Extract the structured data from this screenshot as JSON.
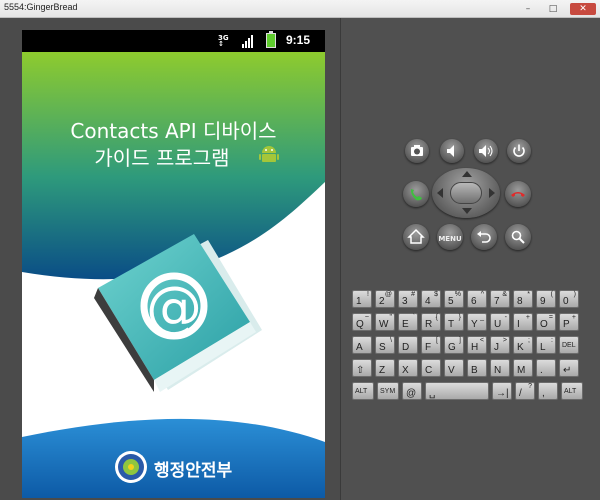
{
  "window": {
    "title": "5554:GingerBread",
    "min": "–",
    "max": "□",
    "close": "✕"
  },
  "status_bar": {
    "network": "3G",
    "time": "9:15"
  },
  "app": {
    "title_line1": "Contacts API 디바이스",
    "title_line2": "가이드 프로그램",
    "book_symbol": "@",
    "ministry_name": "행정안전부"
  },
  "hardware_buttons": {
    "camera": "camera-icon",
    "vol_down": "volume-down-icon",
    "vol_up": "volume-up-icon",
    "power": "power-icon",
    "call": "call-icon",
    "end_call": "end-call-icon",
    "home": "home-icon",
    "menu": "MENU",
    "back": "back-icon",
    "search": "search-icon"
  },
  "keyboard": {
    "rows": [
      [
        {
          "k": "1",
          "a": "!"
        },
        {
          "k": "2",
          "a": "@"
        },
        {
          "k": "3",
          "a": "#"
        },
        {
          "k": "4",
          "a": "$"
        },
        {
          "k": "5",
          "a": "%"
        },
        {
          "k": "6",
          "a": "^"
        },
        {
          "k": "7",
          "a": "&"
        },
        {
          "k": "8",
          "a": "*"
        },
        {
          "k": "9",
          "a": "("
        },
        {
          "k": "0",
          "a": ")"
        }
      ],
      [
        {
          "k": "Q",
          "a": "~"
        },
        {
          "k": "W",
          "a": "\""
        },
        {
          "k": "E",
          "a": "`"
        },
        {
          "k": "R",
          "a": "{"
        },
        {
          "k": "T",
          "a": "}"
        },
        {
          "k": "Y",
          "a": "_"
        },
        {
          "k": "U",
          "a": "-"
        },
        {
          "k": "I",
          "a": "+"
        },
        {
          "k": "O",
          "a": "="
        },
        {
          "k": "P",
          "a": "+"
        }
      ],
      [
        {
          "k": "A",
          "a": ""
        },
        {
          "k": "S",
          "a": "\\"
        },
        {
          "k": "D",
          "a": ""
        },
        {
          "k": "F",
          "a": "["
        },
        {
          "k": "G",
          "a": "]"
        },
        {
          "k": "H",
          "a": "<"
        },
        {
          "k": "J",
          "a": ">"
        },
        {
          "k": "K",
          "a": ";"
        },
        {
          "k": "L",
          "a": ":"
        },
        {
          "k": "DEL",
          "a": ""
        }
      ],
      [
        {
          "k": "⇧",
          "a": ""
        },
        {
          "k": "Z",
          "a": ""
        },
        {
          "k": "X",
          "a": ""
        },
        {
          "k": "C",
          "a": ""
        },
        {
          "k": "V",
          "a": ""
        },
        {
          "k": "B",
          "a": ""
        },
        {
          "k": "N",
          "a": ""
        },
        {
          "k": "M",
          "a": ""
        },
        {
          "k": ".",
          "a": ""
        },
        {
          "k": "↵",
          "a": ""
        }
      ],
      [
        {
          "k": "ALT",
          "a": ""
        },
        {
          "k": "SYM",
          "a": ""
        },
        {
          "k": "@",
          "a": ""
        },
        {
          "k": "␣",
          "a": ""
        },
        {
          "k": "→|",
          "a": ""
        },
        {
          "k": "/",
          "a": "?"
        },
        {
          "k": ",",
          "a": ""
        },
        {
          "k": "ALT",
          "a": ""
        }
      ]
    ]
  },
  "colors": {
    "header_green": "#7cbf2a",
    "footer_blue": "#1f77c4",
    "book_teal": "#3eb6b8"
  }
}
